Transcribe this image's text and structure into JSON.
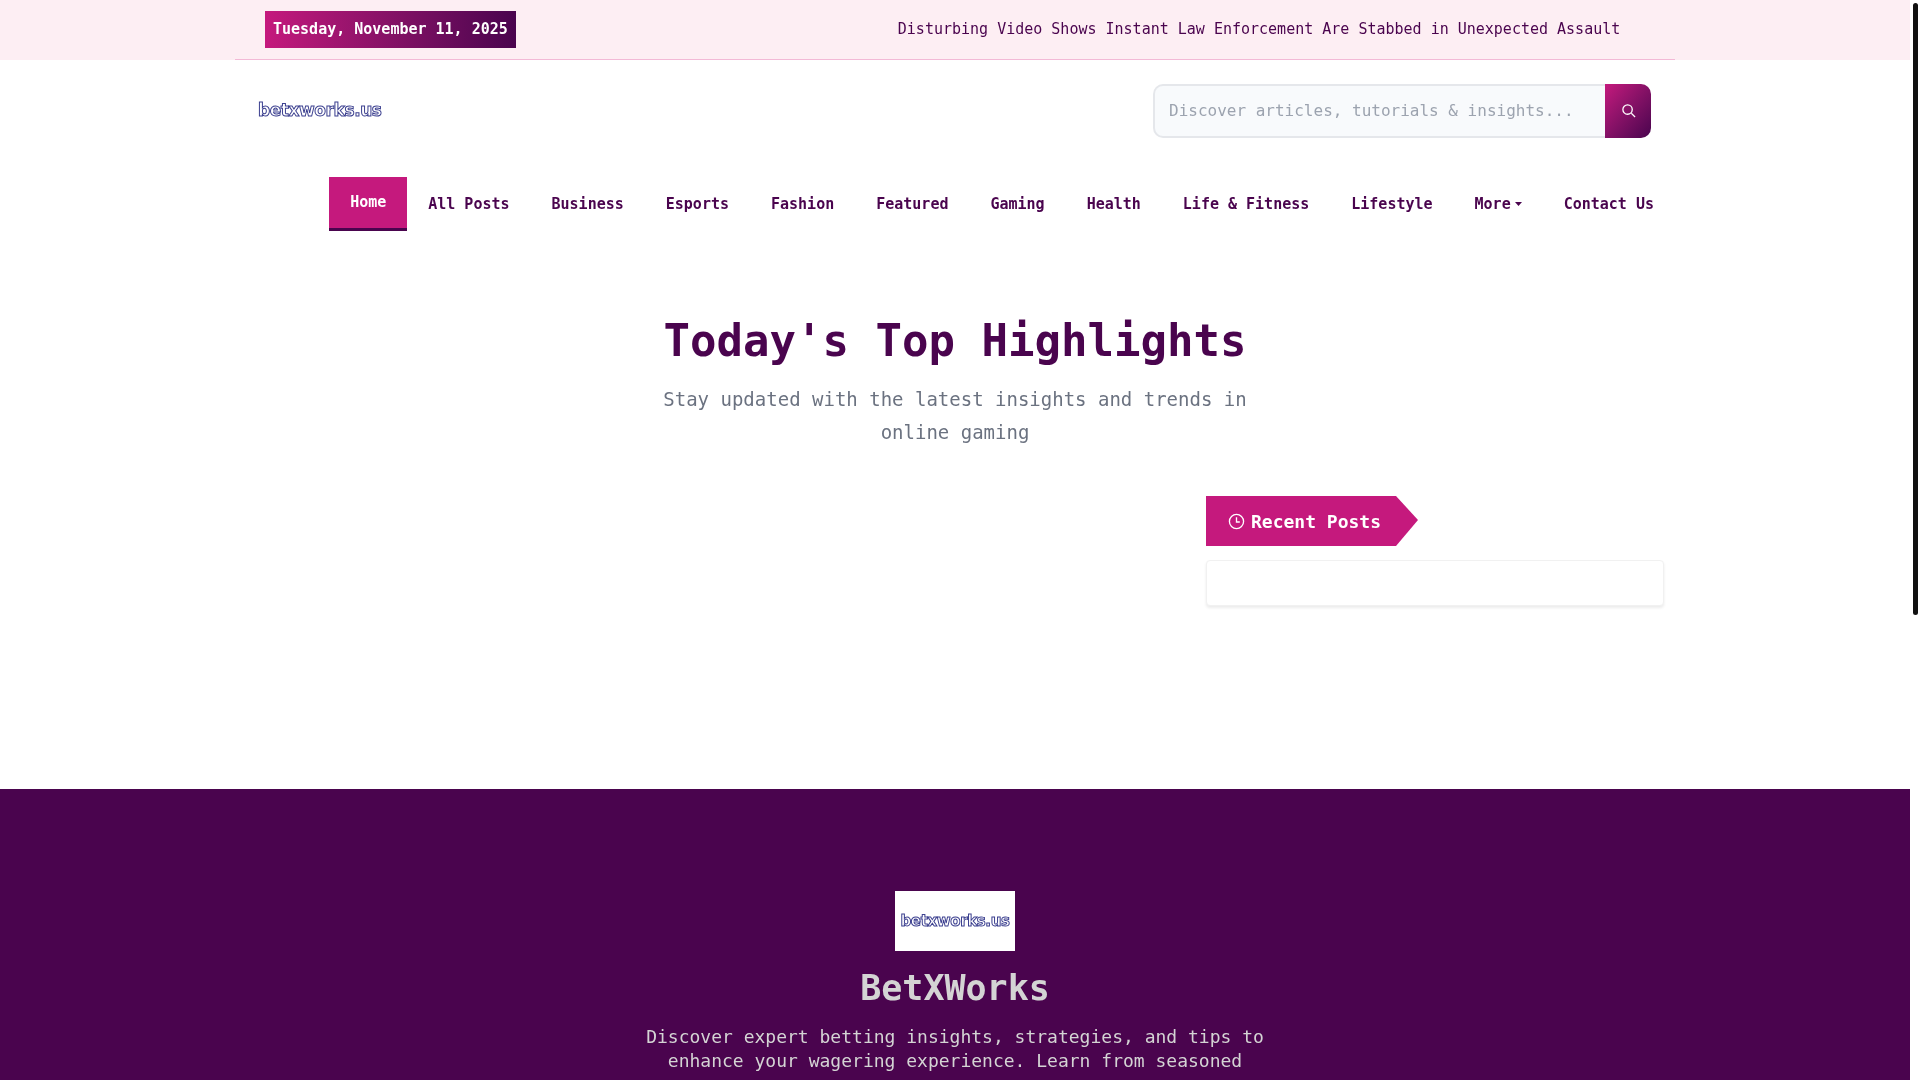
{
  "top_bar": {
    "date": "Tuesday, November 11, 2025",
    "ticker": "Disturbing Video Shows Instant Law Enforcement Are Stabbed in Unexpected Assault"
  },
  "header": {
    "logo": "betxworks.us",
    "search": {
      "placeholder": "Discover articles, tutorials & insights..."
    }
  },
  "nav": [
    {
      "label": "Home",
      "selected": true,
      "dropdown": false
    },
    {
      "label": "All Posts",
      "selected": false,
      "dropdown": false
    },
    {
      "label": "Business",
      "selected": false,
      "dropdown": false
    },
    {
      "label": "Esports",
      "selected": false,
      "dropdown": false
    },
    {
      "label": "Fashion",
      "selected": false,
      "dropdown": false
    },
    {
      "label": "Featured",
      "selected": false,
      "dropdown": false
    },
    {
      "label": "Gaming",
      "selected": false,
      "dropdown": false
    },
    {
      "label": "Health",
      "selected": false,
      "dropdown": false
    },
    {
      "label": "Life & Fitness",
      "selected": false,
      "dropdown": false
    },
    {
      "label": "Lifestyle",
      "selected": false,
      "dropdown": false
    },
    {
      "label": "More",
      "selected": false,
      "dropdown": true
    },
    {
      "label": "Contact Us",
      "selected": false,
      "dropdown": false
    }
  ],
  "highlights": {
    "title": "Today's Top Highlights",
    "subtitle": "Stay updated with the latest insights and trends in online gaming"
  },
  "recent_posts": {
    "title": "Recent Posts"
  },
  "footer": {
    "logo": "betxworks.us",
    "name": "BetXWorks",
    "description": "Discover expert betting insights, strategies, and tips to enhance your wagering experience. Learn from seasoned"
  }
}
